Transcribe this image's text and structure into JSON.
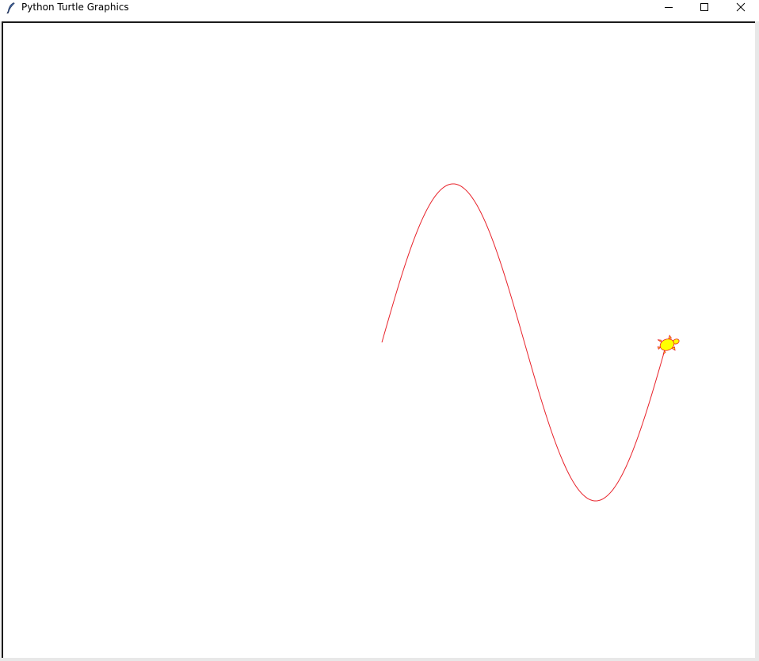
{
  "window": {
    "title": "Python Turtle Graphics",
    "app_icon": "feather-icon",
    "controls": {
      "minimize_icon": "minimize-icon",
      "maximize_icon": "maximize-icon",
      "close_icon": "close-icon"
    }
  },
  "canvas": {
    "background": "#ffffff",
    "path_color": "#e8232b",
    "turtle_fill": "#ffff00",
    "turtle_outline": "#e8232b",
    "turtle_icon": "turtle-icon"
  }
}
